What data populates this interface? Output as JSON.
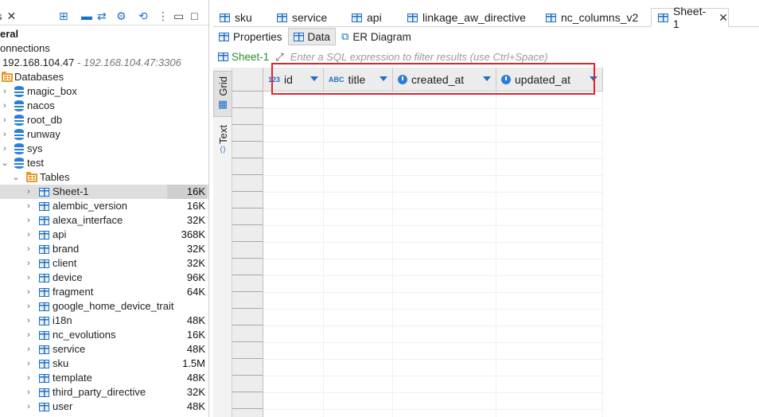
{
  "left_panel": {
    "tab_label": "s",
    "section_title": "eral",
    "connections_label": "onnections",
    "connection_host": "192.168.104.47",
    "connection_detail": "- 192.168.104.47:3306",
    "databases_label": "Databases",
    "databases": [
      "magic_box",
      "nacos",
      "root_db",
      "runway",
      "sys"
    ],
    "active_db": "test",
    "tables_label": "Tables",
    "tables": [
      {
        "name": "Sheet-1",
        "size": "16K"
      },
      {
        "name": "alembic_version",
        "size": "16K"
      },
      {
        "name": "alexa_interface",
        "size": "32K"
      },
      {
        "name": "api",
        "size": "368K"
      },
      {
        "name": "brand",
        "size": "32K"
      },
      {
        "name": "client",
        "size": "32K"
      },
      {
        "name": "device",
        "size": "96K"
      },
      {
        "name": "fragment",
        "size": "64K"
      },
      {
        "name": "google_home_device_trait",
        "size": ""
      },
      {
        "name": "i18n",
        "size": "48K"
      },
      {
        "name": "nc_evolutions",
        "size": "16K"
      },
      {
        "name": "service",
        "size": "48K"
      },
      {
        "name": "sku",
        "size": "1.5M"
      },
      {
        "name": "template",
        "size": "48K"
      },
      {
        "name": "third_party_directive",
        "size": "32K"
      },
      {
        "name": "user",
        "size": "48K"
      }
    ]
  },
  "editor_tabs": [
    "sku",
    "service",
    "api",
    "linkage_aw_directive",
    "nc_columns_v2",
    "Sheet-1"
  ],
  "sub_tabs": [
    "Properties",
    "Data",
    "ER Diagram"
  ],
  "filter": {
    "table_name": "Sheet-1",
    "placeholder": "Enter a SQL expression to filter results (use Ctrl+Space)"
  },
  "side_tabs": {
    "grid": "Grid",
    "text": "Text"
  },
  "columns": [
    {
      "name": "id",
      "type_badge": "123"
    },
    {
      "name": "title",
      "type_badge": "ABC"
    },
    {
      "name": "created_at",
      "type_badge": "clock"
    },
    {
      "name": "updated_at",
      "type_badge": "clock"
    }
  ],
  "colors": {
    "accent": "#1f6fc4",
    "highlight": "#e8212a",
    "filter_name": "#2e8b2e"
  }
}
